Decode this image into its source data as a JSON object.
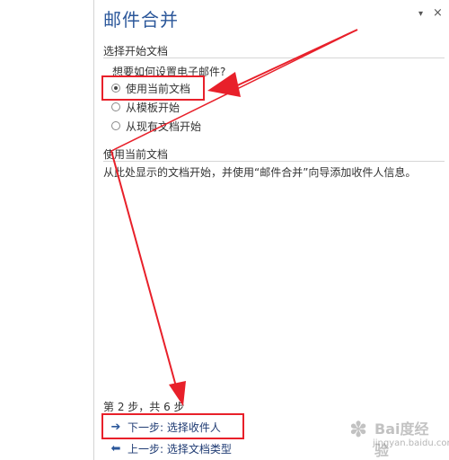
{
  "pane": {
    "title": "邮件合并",
    "dropdown_glyph": "▾",
    "close_glyph": "×"
  },
  "select_document": {
    "section_title": "选择开始文档",
    "question": "想要如何设置电子邮件?",
    "options": [
      {
        "label": "使用当前文档",
        "checked": true
      },
      {
        "label": "从模板开始",
        "checked": false
      },
      {
        "label": "从现有文档开始",
        "checked": false
      }
    ]
  },
  "current_document": {
    "section_title": "使用当前文档",
    "description": "从此处显示的文档开始，并使用“邮件合并”向导添加收件人信息。"
  },
  "steps": {
    "counter": "第 2 步，共 6 步",
    "next": {
      "arrow": "➔",
      "label": "下一步: 选择收件人"
    },
    "prev": {
      "arrow": "⬅",
      "label": "上一步: 选择文档类型"
    }
  },
  "watermark": {
    "text": "Bai度经验",
    "url": "jingyan.baidu.com"
  },
  "annotation_color": "#e8202a"
}
